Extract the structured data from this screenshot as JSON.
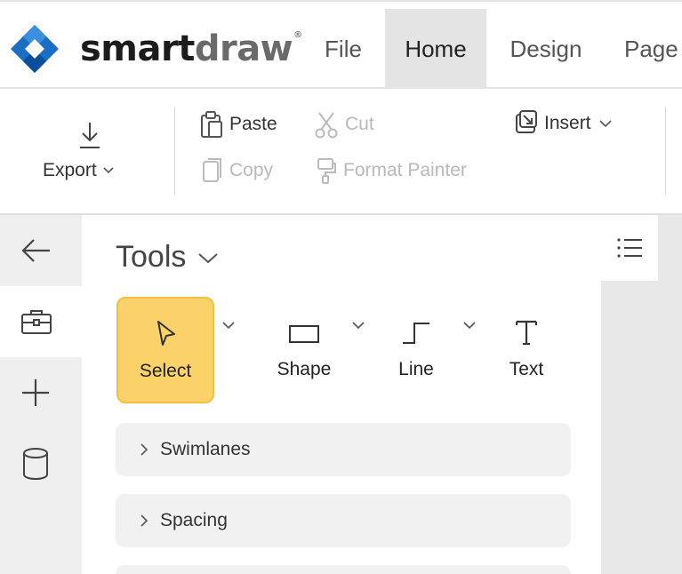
{
  "app": {
    "logo_part1": "smart",
    "logo_part2": "draw",
    "logo_tm": "®",
    "colors": {
      "logo_blue": "#1a6fc4",
      "logo_blue_dark": "#0b4f9c",
      "select_accent": "#fbd26a"
    }
  },
  "menu": {
    "tabs": [
      {
        "label": "File",
        "active": false
      },
      {
        "label": "Home",
        "active": true
      },
      {
        "label": "Design",
        "active": false
      },
      {
        "label": "Page",
        "active": false
      }
    ]
  },
  "ribbon": {
    "export_label": "Export",
    "paste_label": "Paste",
    "copy_label": "Copy",
    "cut_label": "Cut",
    "format_painter_label": "Format Painter",
    "insert_label": "Insert",
    "icons": [
      "download-icon",
      "paste-icon",
      "copy-icon",
      "scissors-icon",
      "format-painter-icon",
      "insert-icon"
    ]
  },
  "rail": {
    "items": [
      {
        "icon": "back-arrow-icon"
      },
      {
        "icon": "toolbox-icon",
        "active": true
      },
      {
        "icon": "plus-icon"
      },
      {
        "icon": "database-icon"
      }
    ]
  },
  "tools_panel": {
    "title": "Tools",
    "tools": [
      {
        "label": "Select",
        "icon": "pointer-icon",
        "selected": true
      },
      {
        "label": "Shape",
        "icon": "rectangle-icon"
      },
      {
        "label": "Line",
        "icon": "connector-line-icon"
      },
      {
        "label": "Text",
        "icon": "text-icon"
      }
    ],
    "sections": [
      {
        "label": "Swimlanes"
      },
      {
        "label": "Spacing"
      }
    ]
  }
}
